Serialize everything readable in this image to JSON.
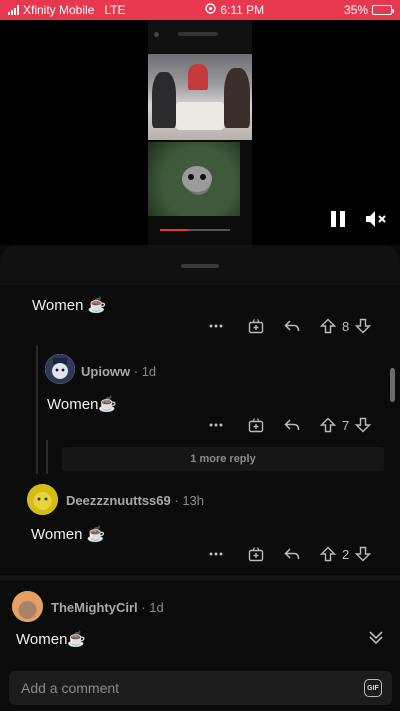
{
  "status_bar": {
    "carrier": "Xfinity Mobile",
    "network": "LTE",
    "time": "6:11 PM",
    "battery": "35%",
    "battery_level": 0.35,
    "background_color": "#e8384f"
  },
  "video": {
    "pause_icon": "pause-icon",
    "mute_icon": "speaker-muted-icon"
  },
  "comments": [
    {
      "text": "Women ☕",
      "score": "8"
    },
    {
      "username": "Upioww",
      "age": "1d",
      "text": "Women☕",
      "score": "7"
    },
    {
      "more_replies": "1 more reply"
    },
    {
      "username": "Deezzznuuttss69",
      "age": "13h",
      "text": "Women ☕",
      "score": "2"
    },
    {
      "username": "TheMightyCirl",
      "age": "1d",
      "text": "Women☕"
    }
  ],
  "composer": {
    "placeholder": "Add a comment",
    "gif_label": "GIF"
  },
  "colors": {
    "background": "#000000",
    "sheet": "#0b0b0b",
    "text": "#f0f0f0",
    "muted": "#8a8a8a",
    "accent": "#e8384f"
  }
}
